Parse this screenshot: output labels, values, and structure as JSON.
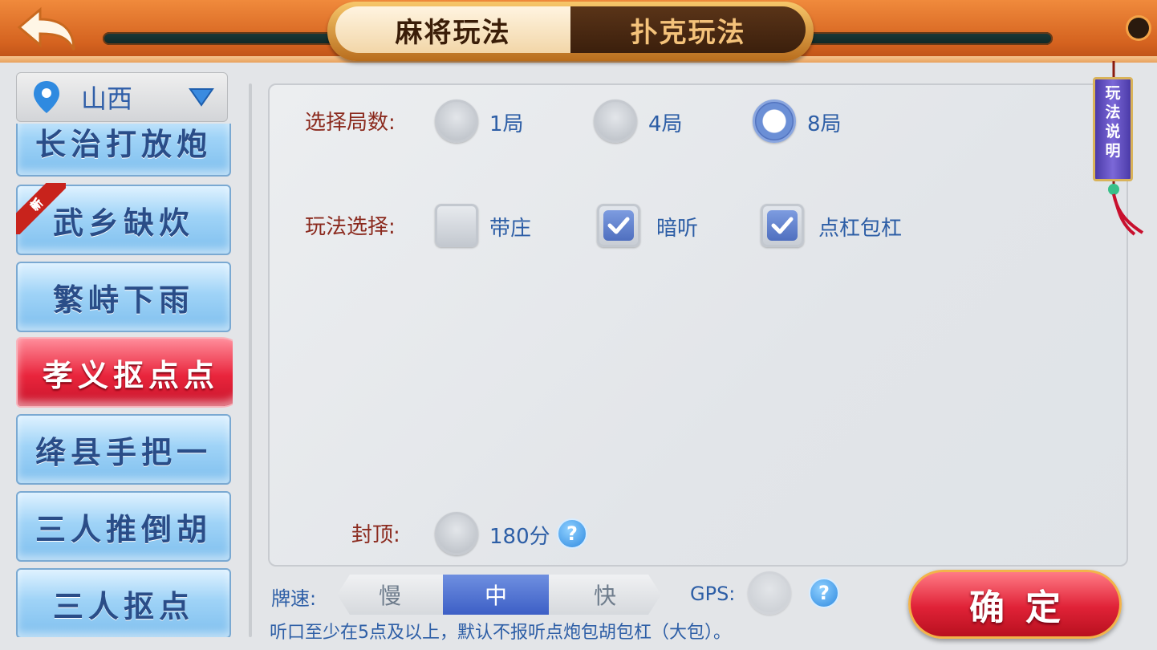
{
  "header": {
    "tabs": [
      {
        "label": "麻将玩法",
        "selected": true
      },
      {
        "label": "扑克玩法",
        "selected": false
      }
    ],
    "back_icon": "back-arrow-icon"
  },
  "region": {
    "name": "山西",
    "icon": "location-pin-icon",
    "dropdown_icon": "triangle-down-icon"
  },
  "games": [
    {
      "label": "长治打放炮",
      "selected": false,
      "new": false
    },
    {
      "label": "武乡缺炊",
      "selected": false,
      "new": true,
      "new_label": "新"
    },
    {
      "label": "繁峙下雨",
      "selected": false,
      "new": false
    },
    {
      "label": "孝义抠点点",
      "selected": true,
      "new": false
    },
    {
      "label": "绛县手把一",
      "selected": false,
      "new": false
    },
    {
      "label": "三人推倒胡",
      "selected": false,
      "new": false
    },
    {
      "label": "三人抠点",
      "selected": false,
      "new": false
    }
  ],
  "rules_scroll": {
    "label": "玩法说明"
  },
  "settings": {
    "rounds": {
      "label": "选择局数:",
      "options": [
        {
          "label": "1局",
          "selected": false
        },
        {
          "label": "4局",
          "selected": false
        },
        {
          "label": "8局",
          "selected": true
        }
      ]
    },
    "play": {
      "label": "玩法选择:",
      "options": [
        {
          "label": "带庄",
          "checked": false
        },
        {
          "label": "暗听",
          "checked": true
        },
        {
          "label": "点杠包杠",
          "checked": true
        }
      ]
    },
    "cap": {
      "label": "封顶:",
      "value": "180分",
      "selected": false,
      "help": "?"
    }
  },
  "bottom": {
    "speed_label": "牌速:",
    "speed_options": [
      {
        "label": "慢",
        "selected": false
      },
      {
        "label": "中",
        "selected": true
      },
      {
        "label": "快",
        "selected": false
      }
    ],
    "gps_label": "GPS:",
    "gps_help": "?",
    "confirm_label": "确定",
    "notice": "听口至少在5点及以上，默认不报听点炮包胡包杠（大包）。"
  },
  "colors": {
    "header": "#e07028",
    "label_red": "#8b2a1e",
    "text_blue": "#2d5ea6",
    "selected_game": "#e9253c",
    "selected_speed": "#3d5fc6"
  }
}
